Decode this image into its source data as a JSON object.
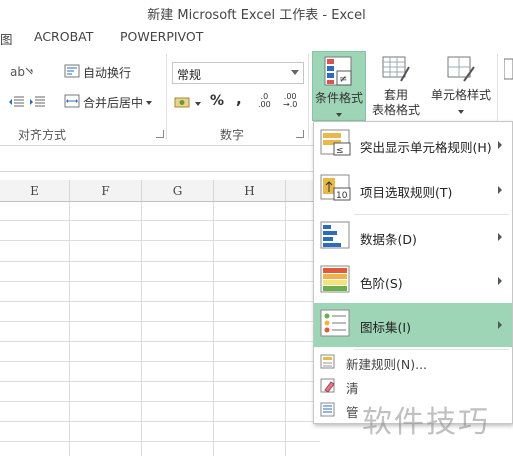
{
  "window": {
    "title": "新建 Microsoft Excel 工作表 - Excel"
  },
  "menu": {
    "items": [
      "图",
      "ACROBAT",
      "POWERPIVOT"
    ]
  },
  "ribbon": {
    "wrap_text": "自动换行",
    "merge_center": "合并后居中",
    "alignment_group": "对齐方式",
    "number_format_value": "常规",
    "percent_symbol": "%",
    "comma_symbol": ",",
    "number_group": "数字",
    "conditional_formatting": "条件格式",
    "format_as_table_line1": "套用",
    "format_as_table_line2": "表格格式",
    "cell_styles": "单元格样式",
    "inc_decimal_top": ".0",
    "inc_decimal_bottom": ".00",
    "dec_decimal_top": ".00",
    "dec_decimal_bottom": "→.0"
  },
  "grid": {
    "columns": [
      "E",
      "F",
      "G",
      "H"
    ]
  },
  "dropdown": {
    "items": [
      {
        "label": "突出显示单元格规则(H)",
        "highlighted": false
      },
      {
        "label": "项目选取规则(T)",
        "highlighted": false
      },
      {
        "label": "数据条(D)",
        "highlighted": false
      },
      {
        "label": "色阶(S)",
        "highlighted": false
      },
      {
        "label": "图标集(I)",
        "highlighted": true
      }
    ],
    "small_items": [
      "新建规则(N)...",
      "清",
      "管"
    ]
  },
  "watermark": "软件技巧",
  "colors": {
    "accent": "#9fd5b7",
    "accent_border": "#86c5a1",
    "icon_red": "#d9534f",
    "icon_blue": "#2e6bbd"
  }
}
